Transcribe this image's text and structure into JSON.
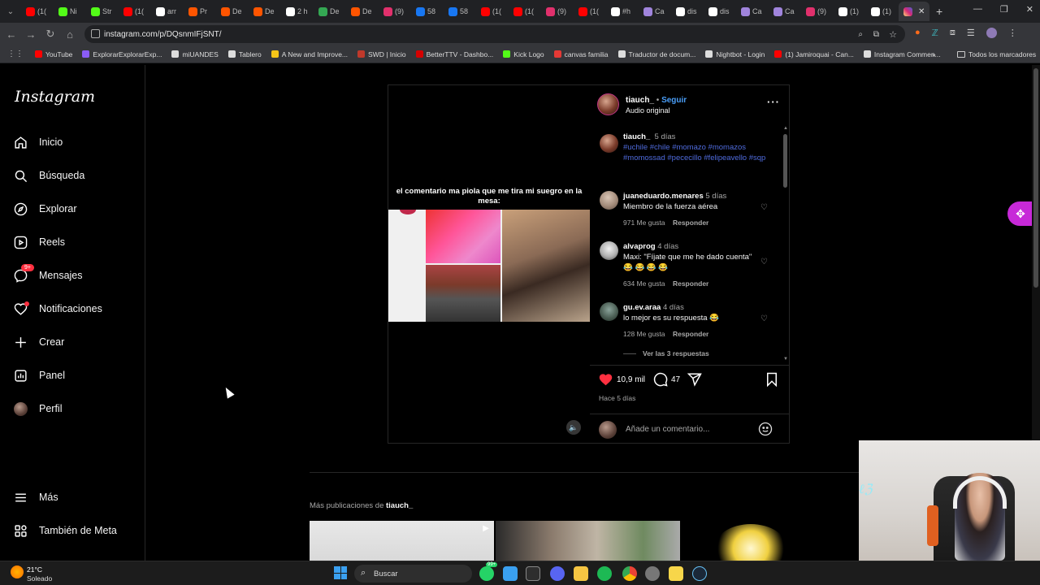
{
  "browser": {
    "tabs": [
      {
        "label": "(1(",
        "color": "#ff0000"
      },
      {
        "label": "Ni",
        "color": "#53fc18"
      },
      {
        "label": "Str",
        "color": "#53fc18"
      },
      {
        "label": "(1(",
        "color": "#ff0000"
      },
      {
        "label": "arr",
        "color": "#ffffff"
      },
      {
        "label": "Pr",
        "color": "#ff5500"
      },
      {
        "label": "De",
        "color": "#ff5500"
      },
      {
        "label": "De",
        "color": "#ff5500"
      },
      {
        "label": "2 h",
        "color": "#ffffff"
      },
      {
        "label": "De",
        "color": "#34a853"
      },
      {
        "label": "De",
        "color": "#ff5500"
      },
      {
        "label": "(9)",
        "color": "#e1306c"
      },
      {
        "label": "58",
        "color": "#1877f2"
      },
      {
        "label": "58",
        "color": "#1877f2"
      },
      {
        "label": "(1(",
        "color": "#ff0000"
      },
      {
        "label": "(1(",
        "color": "#ff0000"
      },
      {
        "label": "(9)",
        "color": "#e1306c"
      },
      {
        "label": "(1(",
        "color": "#ff0000"
      },
      {
        "label": "#h",
        "color": "#ffffff"
      },
      {
        "label": "Ca",
        "color": "#a084dc"
      },
      {
        "label": "dis",
        "color": "#ffffff"
      },
      {
        "label": "dis",
        "color": "#ffffff"
      },
      {
        "label": "Ca",
        "color": "#a084dc"
      },
      {
        "label": "Ca",
        "color": "#a084dc"
      },
      {
        "label": "(9)",
        "color": "#e1306c"
      },
      {
        "label": "(1)",
        "color": "#ffffff"
      },
      {
        "label": "(1)",
        "color": "#ffffff"
      }
    ],
    "url": "instagram.com/p/DQsnmIFjSNT/",
    "bookmarks": [
      {
        "label": "YouTube",
        "color": "#ff0000"
      },
      {
        "label": "ExplorarExplorarExp...",
        "color": "#8a5cf6"
      },
      {
        "label": "miUANDES",
        "color": "#dddddd"
      },
      {
        "label": "Tablero",
        "color": "#dddddd"
      },
      {
        "label": "A New and Improve...",
        "color": "#f5c518"
      },
      {
        "label": "SWD | Inicio",
        "color": "#c0392b"
      },
      {
        "label": "BetterTTV - Dashbo...",
        "color": "#d50000"
      },
      {
        "label": "Kick Logo",
        "color": "#53fc18"
      },
      {
        "label": "canvas familia",
        "color": "#e53935"
      },
      {
        "label": "Traductor de docum...",
        "color": "#dddddd"
      },
      {
        "label": "Nightbot - Login",
        "color": "#dddddd"
      },
      {
        "label": "(1) Jamiroquai - Can...",
        "color": "#ff0000"
      },
      {
        "label": "Instagram Commen...",
        "color": "#dddddd"
      }
    ],
    "all_bookmarks": "Todos los marcadores"
  },
  "sidebar": {
    "logo": "Instagram",
    "items": [
      {
        "label": "Inicio"
      },
      {
        "label": "Búsqueda"
      },
      {
        "label": "Explorar"
      },
      {
        "label": "Reels"
      },
      {
        "label": "Mensajes",
        "badge": "9+"
      },
      {
        "label": "Notificaciones"
      },
      {
        "label": "Crear"
      },
      {
        "label": "Panel"
      },
      {
        "label": "Perfil"
      }
    ],
    "more": "Más",
    "meta": "También de Meta"
  },
  "post": {
    "video_caption": "el comentario ma piola que me tira mi suegro en la mesa:",
    "author": "tiauch_",
    "follow": "Seguir",
    "separator": " • ",
    "audio": "Audio original",
    "caption": {
      "user": "tiauch_",
      "time": "5 días",
      "hashtags": "#uchile #chile #momazo #momazos #momossad #pececillo #felipeavello #sqp"
    },
    "comments": [
      {
        "user": "juaneduardo.menares",
        "time": "5 días",
        "text": "Miembro de la fuerza aérea",
        "likes": "971 Me gusta",
        "reply": "Responder"
      },
      {
        "user": "alvaprog",
        "time": "4 días",
        "text": "Maxi: \"Fíjate que me he dado cuenta\" 😂 😂 😂 😂",
        "likes": "634 Me gusta",
        "reply": "Responder"
      },
      {
        "user": "gu.ev.araa",
        "time": "4 días",
        "text": "lo mejor es su respuesta 😂",
        "likes": "128 Me gusta",
        "reply": "Responder",
        "view_replies": "Ver las 3 respuestas"
      }
    ],
    "likes": "10,9 mil",
    "comment_count": "47",
    "posted": "Hace 5 días",
    "add_comment_placeholder": "Añade un comentario..."
  },
  "more_posts": {
    "prefix": "Más publicaciones de ",
    "user": "tiauch_"
  },
  "taskbar": {
    "temperature": "21°C",
    "weather": "Soleado",
    "search": "Buscar",
    "notification_badge": "99+"
  }
}
